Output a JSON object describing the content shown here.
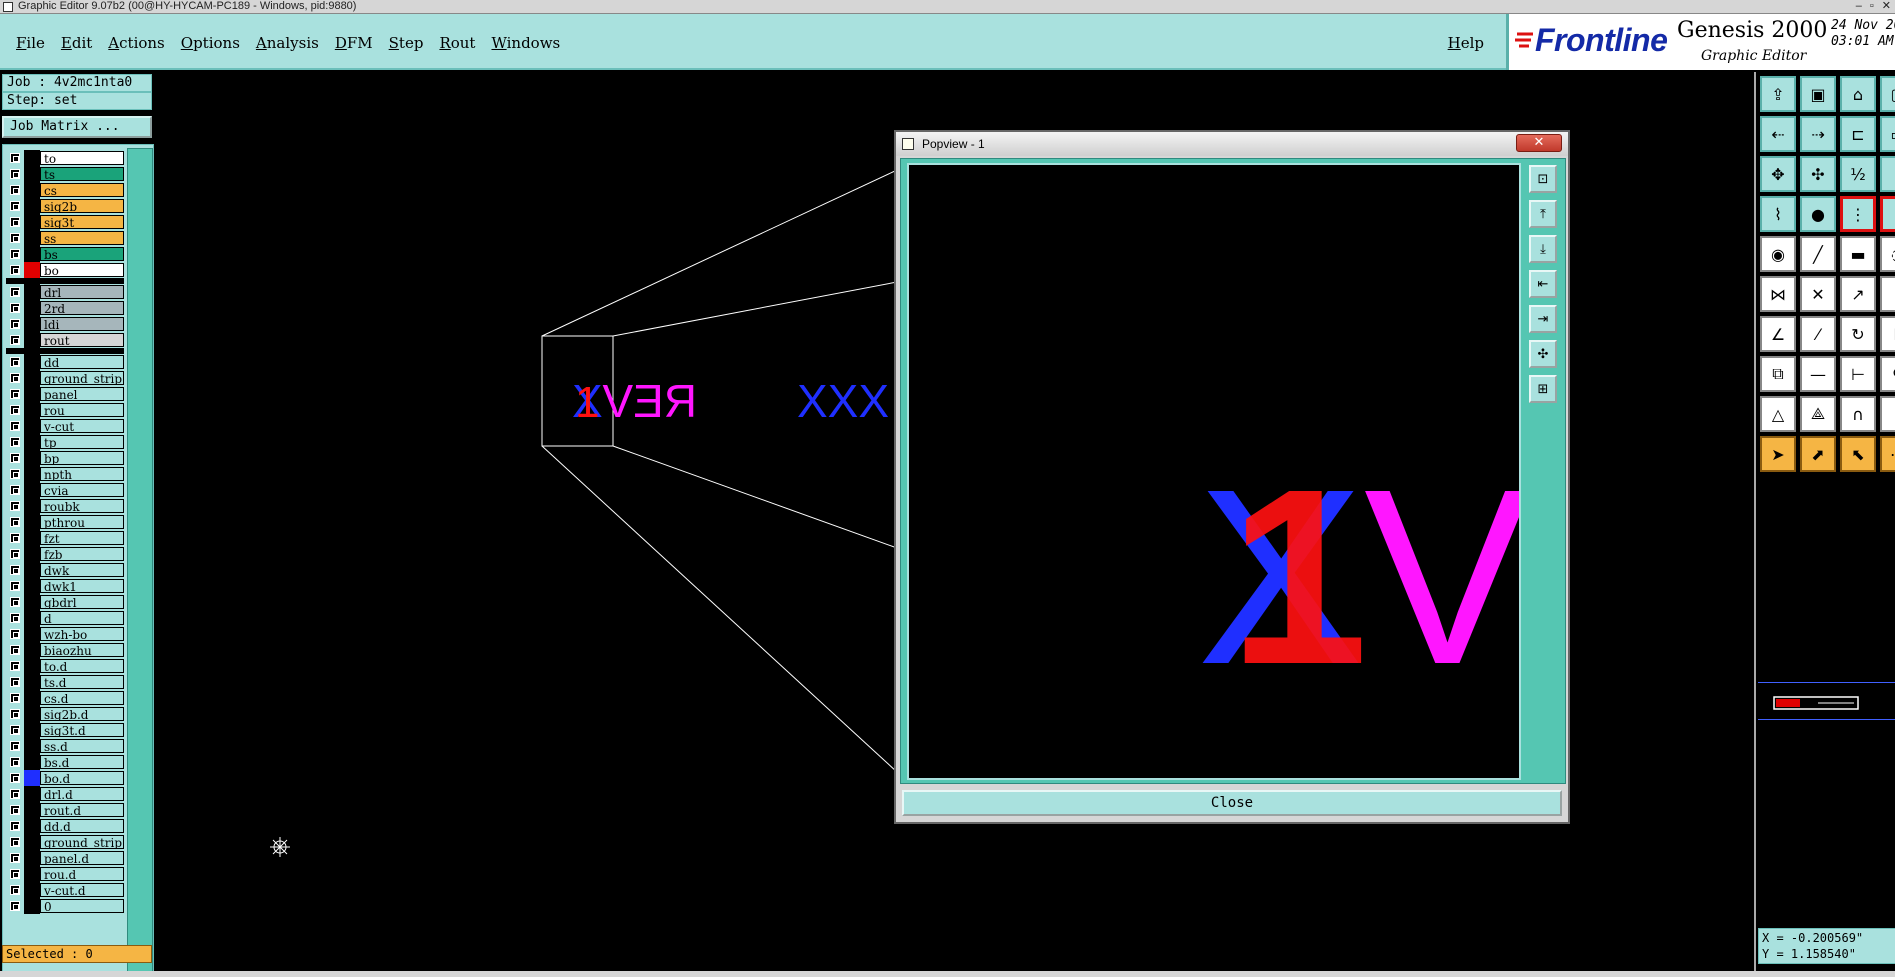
{
  "window": {
    "title": "Graphic Editor 9.07b2 (00@HY-HYCAM-PC189 - Windows, pid:9880)",
    "controls": [
      "–",
      "▫",
      "✕"
    ]
  },
  "menubar": {
    "items": [
      "File",
      "Edit",
      "Actions",
      "Options",
      "Analysis",
      "DFM",
      "Step",
      "Rout",
      "Windows"
    ],
    "help": "Help"
  },
  "brand": {
    "logo_text": "Frontline",
    "product": "Genesis 2000",
    "subtitle": "Graphic Editor",
    "date_line1": "24 Nov 20",
    "date_line2": "03:01 AM"
  },
  "left_panel": {
    "job_label": "Job : 4v2mc1nta0",
    "step_label": "Step: set",
    "job_matrix_button": "Job Matrix ...",
    "selected_label": "Selected : 0"
  },
  "layers": {
    "group1": [
      {
        "name": "to",
        "color": "#ffffff",
        "swatch": "#000000"
      },
      {
        "name": "ts",
        "color": "#1aa37a",
        "swatch": "#000000"
      },
      {
        "name": "cs",
        "color": "#f5b544",
        "swatch": "#000000"
      },
      {
        "name": "sig2b",
        "color": "#f5b544",
        "swatch": "#000000"
      },
      {
        "name": "sig3t",
        "color": "#f5b544",
        "swatch": "#000000"
      },
      {
        "name": "ss",
        "color": "#f5b544",
        "swatch": "#000000"
      },
      {
        "name": "bs",
        "color": "#1aa37a",
        "swatch": "#000000"
      },
      {
        "name": "bo",
        "color": "#ffffff",
        "swatch": "#e00000"
      }
    ],
    "group2": [
      {
        "name": "drl",
        "color": "#a6b6bb",
        "swatch": "#000000"
      },
      {
        "name": "2rd",
        "color": "#a6b6bb",
        "swatch": "#000000"
      },
      {
        "name": "ldi",
        "color": "#a6b6bb",
        "swatch": "#000000"
      },
      {
        "name": "rout",
        "color": "#d6d6d6",
        "swatch": "#000000"
      }
    ],
    "group3": [
      {
        "name": "dd",
        "swatch": "#000000"
      },
      {
        "name": "ground_strip",
        "swatch": "#000000"
      },
      {
        "name": "panel",
        "swatch": "#000000"
      },
      {
        "name": "rou",
        "swatch": "#000000"
      },
      {
        "name": "v-cut",
        "swatch": "#000000"
      },
      {
        "name": "tp",
        "swatch": "#000000"
      },
      {
        "name": "bp",
        "swatch": "#000000"
      },
      {
        "name": "npth",
        "swatch": "#000000"
      },
      {
        "name": "cvia",
        "swatch": "#000000"
      },
      {
        "name": "roubk",
        "swatch": "#000000"
      },
      {
        "name": "pthrou",
        "swatch": "#000000"
      },
      {
        "name": "fzt",
        "swatch": "#000000"
      },
      {
        "name": "fzb",
        "swatch": "#000000"
      },
      {
        "name": "dwk",
        "swatch": "#000000"
      },
      {
        "name": "dwk1",
        "swatch": "#000000"
      },
      {
        "name": "gbdrl",
        "swatch": "#000000"
      },
      {
        "name": "d",
        "swatch": "#000000"
      },
      {
        "name": "wzh-bo",
        "swatch": "#000000"
      },
      {
        "name": "biaozhu",
        "swatch": "#000000"
      },
      {
        "name": "to.d",
        "swatch": "#000000"
      },
      {
        "name": "ts.d",
        "swatch": "#000000"
      },
      {
        "name": "cs.d",
        "swatch": "#000000"
      },
      {
        "name": "sig2b.d",
        "swatch": "#000000"
      },
      {
        "name": "sig3t.d",
        "swatch": "#000000"
      },
      {
        "name": "ss.d",
        "swatch": "#000000"
      },
      {
        "name": "bs.d",
        "swatch": "#000000"
      },
      {
        "name": "bo.d",
        "swatch": "#1f2fff"
      },
      {
        "name": "drl.d",
        "swatch": "#000000"
      },
      {
        "name": "rout.d",
        "swatch": "#000000"
      },
      {
        "name": "dd.d",
        "swatch": "#000000"
      },
      {
        "name": "ground_strip",
        "swatch": "#000000"
      },
      {
        "name": "panel.d",
        "swatch": "#000000"
      },
      {
        "name": "rou.d",
        "swatch": "#000000"
      },
      {
        "name": "v-cut.d",
        "swatch": "#000000"
      },
      {
        "name": "0",
        "swatch": "#000000"
      }
    ]
  },
  "canvas": {
    "text_rev": "REV",
    "text_mirror_x": "X",
    "text_one": "1",
    "text_xxx": "XXX",
    "cursor_icon": "crosshair-icon"
  },
  "popview": {
    "title": "Popview - 1",
    "close_x": "✕",
    "close_button": "Close",
    "zoom_text_x": "X",
    "zoom_text_one": "1",
    "zoom_text_v": "V"
  },
  "coords": {
    "x": "X = -0.200569\"",
    "y": "Y = 1.158540\""
  },
  "colors": {
    "teal": "#a9e1de",
    "dark_teal": "#55c6b2",
    "orange": "#f5b544",
    "magenta": "#ff16ff",
    "blue": "#1f2fff",
    "red": "#ff1010",
    "brand_blue": "#142aa7"
  }
}
